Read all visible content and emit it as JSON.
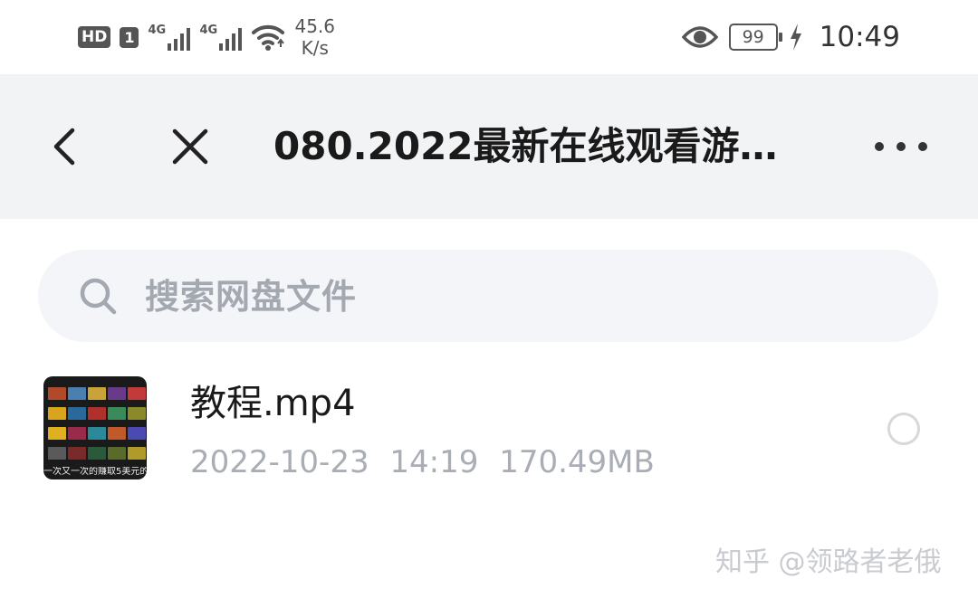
{
  "status_bar": {
    "hd_badge": "HD",
    "sim_badge": "1",
    "signal1_label": "4G",
    "signal2_label": "4G",
    "speed_value": "45.6",
    "speed_unit": "K/s",
    "battery_level": "99",
    "time": "10:49",
    "icons": [
      "wifi-icon",
      "eye-icon",
      "charging-icon"
    ]
  },
  "nav": {
    "title": "080.2022最新在线观看游…",
    "icons": [
      "back-icon",
      "close-icon",
      "more-icon"
    ]
  },
  "search": {
    "placeholder": "搜索网盘文件",
    "icon": "search-icon"
  },
  "files": [
    {
      "name": "教程.mp4",
      "date": "2022-10-23",
      "time": "14:19",
      "size": "170.49MB",
      "thumbnail_caption": "一次又一次的赚取5美元的",
      "selected": false
    }
  ],
  "watermark": "知乎 @领路者老俄",
  "colors": {
    "nav_background": "#f2f3f5",
    "search_background": "#f4f5f8",
    "placeholder_text": "#a3a8b1",
    "meta_text": "#a9adb5"
  }
}
